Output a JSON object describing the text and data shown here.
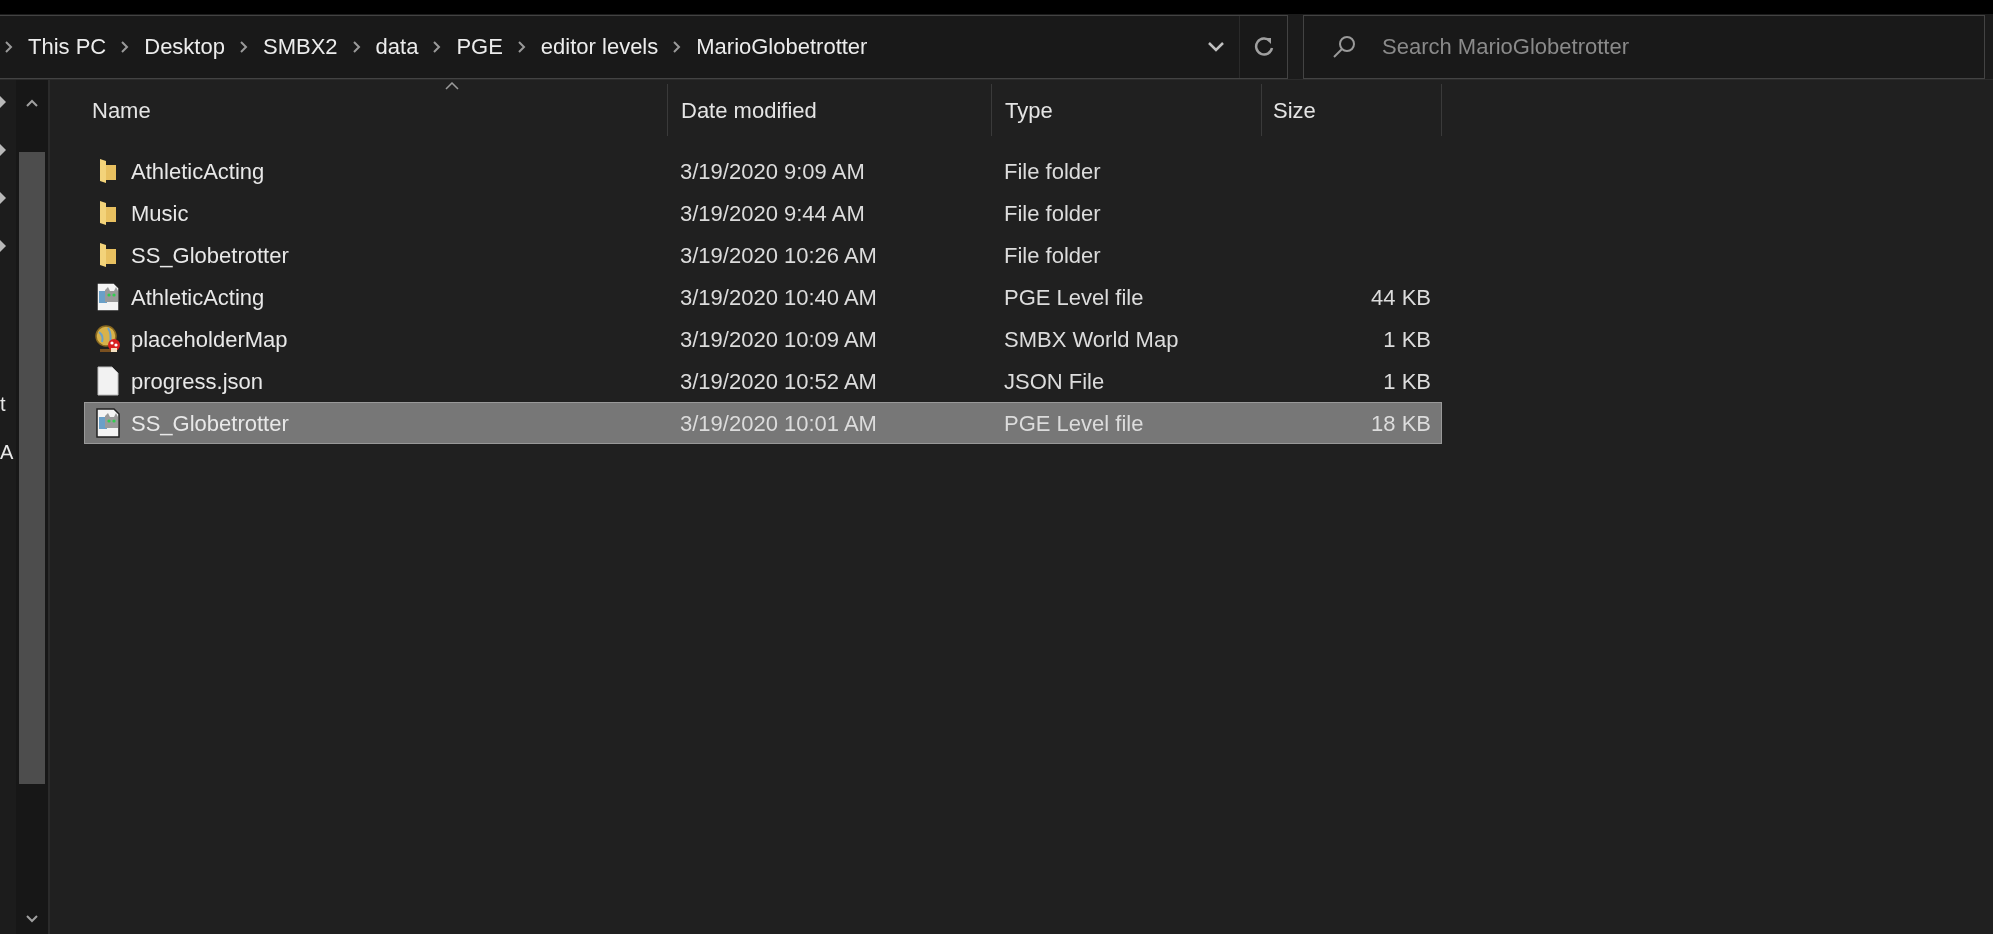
{
  "address_bar": {
    "breadcrumbs": [
      "This PC",
      "Desktop",
      "SMBX2",
      "data",
      "PGE",
      "editor levels",
      "MarioGlobetrotter"
    ]
  },
  "search": {
    "placeholder": "Search MarioGlobetrotter"
  },
  "nav_pane": {
    "items": [
      "t",
      "A"
    ]
  },
  "table": {
    "columns": [
      "Name",
      "Date modified",
      "Type",
      "Size"
    ],
    "rows": [
      {
        "kind": "folder",
        "name": "AthleticActing",
        "date": "3/19/2020 9:09 AM",
        "type": "File folder",
        "selected": false
      },
      {
        "kind": "folder",
        "name": "Music",
        "date": "3/19/2020 9:44 AM",
        "type": "File folder",
        "selected": false
      },
      {
        "kind": "folder",
        "name": "SS_Globetrotter",
        "date": "3/19/2020 10:26 AM",
        "type": "File folder",
        "selected": false
      },
      {
        "kind": "level",
        "name": "AthleticActing",
        "date": "3/19/2020 10:40 AM",
        "type": "PGE Level file",
        "size": "44 KB",
        "selected": false
      },
      {
        "kind": "worldmap",
        "name": "placeholderMap",
        "date": "3/19/2020 10:09 AM",
        "type": "SMBX World Map",
        "size": "1 KB",
        "selected": false
      },
      {
        "kind": "file",
        "name": "progress.json",
        "date": "3/19/2020 10:52 AM",
        "type": "JSON File",
        "size": "1 KB",
        "selected": false
      },
      {
        "kind": "level",
        "name": "SS_Globetrotter",
        "date": "3/19/2020 10:01 AM",
        "type": "PGE Level file",
        "size": "18 KB",
        "selected": true
      }
    ]
  }
}
